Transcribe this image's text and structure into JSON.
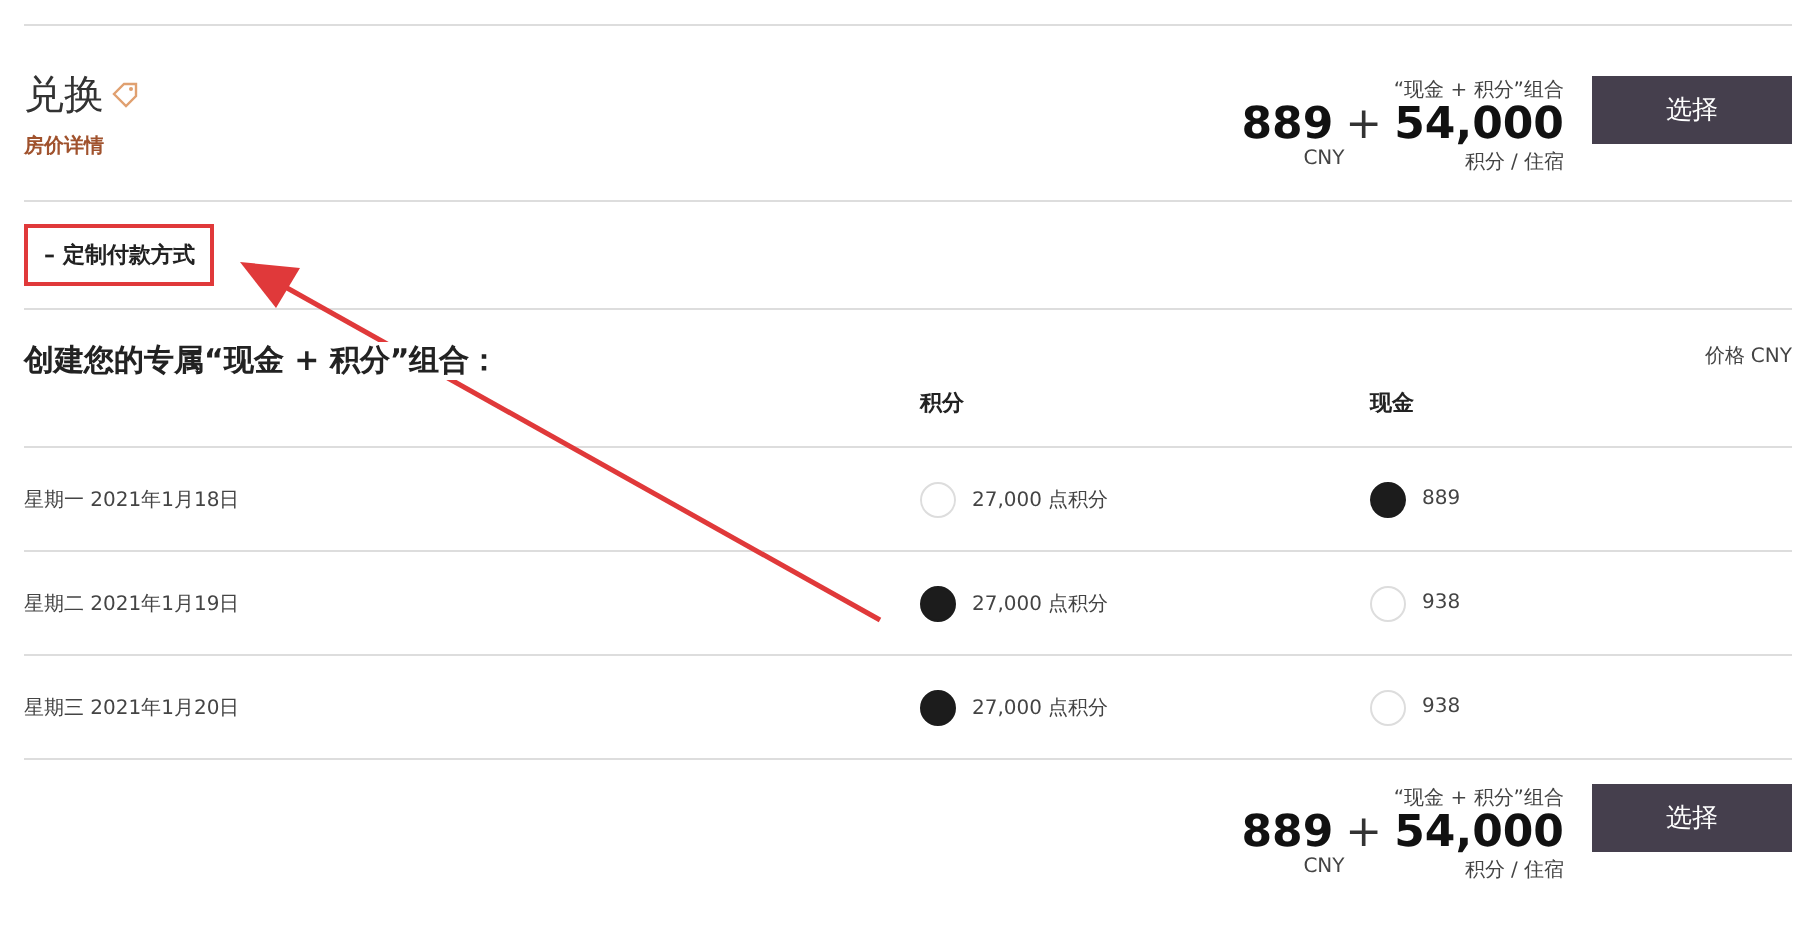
{
  "offer": {
    "title": "兑换",
    "link": "房价详情",
    "price": {
      "label": "“现金 + 积分”组合",
      "cash": "889",
      "plus": "+",
      "points": "54,000",
      "cash_unit": "CNY",
      "points_unit": "积分 / 住宿"
    },
    "button": "选择"
  },
  "customize": {
    "symbol": "–",
    "label": "定制付款方式",
    "expanded": true
  },
  "builder": {
    "heading": "创建您的专属“现金 + 积分”组合：",
    "currency_note": "价格 CNY",
    "columns": [
      "积分",
      "现金"
    ],
    "rows": [
      {
        "date": "星期一 2021年1月18日",
        "options": [
          {
            "label": "27,000 点积分",
            "selected": false
          },
          {
            "label": "889",
            "selected": true
          }
        ]
      },
      {
        "date": "星期二 2021年1月19日",
        "options": [
          {
            "label": "27,000 点积分",
            "selected": true
          },
          {
            "label": "938",
            "selected": false
          }
        ]
      },
      {
        "date": "星期三 2021年1月20日",
        "options": [
          {
            "label": "27,000 点积分",
            "selected": true
          },
          {
            "label": "938",
            "selected": false
          }
        ]
      }
    ]
  },
  "footer": {
    "price": {
      "label": "“现金 + 积分”组合",
      "cash": "889",
      "plus": "+",
      "points": "54,000",
      "cash_unit": "CNY",
      "points_unit": "积分 / 住宿"
    },
    "button": "选择"
  }
}
